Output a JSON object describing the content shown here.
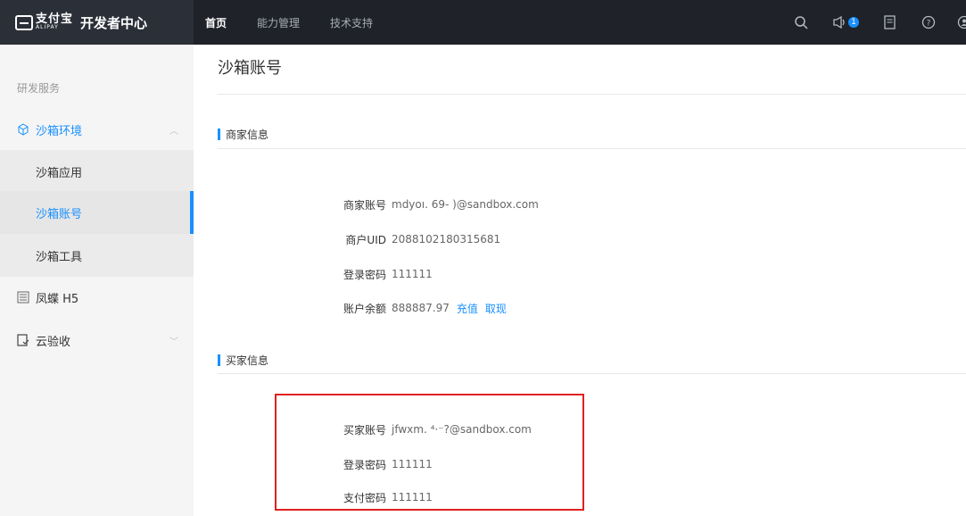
{
  "header": {
    "brand_cn": "支付宝",
    "brand_en": "ALIPAY",
    "title": "开发者中心",
    "nav": [
      "首页",
      "能力管理",
      "技术支持"
    ],
    "icons": [
      "search-icon",
      "announcement-icon",
      "document-icon",
      "help-icon",
      "user-icon"
    ],
    "announcement_badge": "1"
  },
  "sidebar": {
    "group_label": "研发服务",
    "sandbox_env": "沙箱环境",
    "sandbox_app": "沙箱应用",
    "sandbox_account": "沙箱账号",
    "sandbox_tools": "沙箱工具",
    "fengdie": "凤蝶 H5",
    "cloud_accept": "云验收"
  },
  "main": {
    "title": "沙箱账号",
    "merchant": {
      "heading": "商家信息",
      "account_label": "商家账号",
      "account_value": "mdyoı. 69- )@sandbox.com",
      "uid_label": "商户UID",
      "uid_value": "2088102180315681",
      "password_label": "登录密码",
      "password_value": "111111",
      "balance_label": "账户余额",
      "balance_value": "888887.97",
      "recharge": "充值",
      "withdraw": "取现"
    },
    "buyer": {
      "heading": "买家信息",
      "account_label": "买家账号",
      "account_value": "jfwxm. ⁴·⁻?@sandbox.com",
      "login_password_label": "登录密码",
      "login_password_value": "111111",
      "pay_password_label": "支付密码",
      "pay_password_value": "111111"
    }
  },
  "colors": {
    "accent": "#1890ff",
    "topbar": "#1f2229",
    "highlight": "#e02020"
  }
}
